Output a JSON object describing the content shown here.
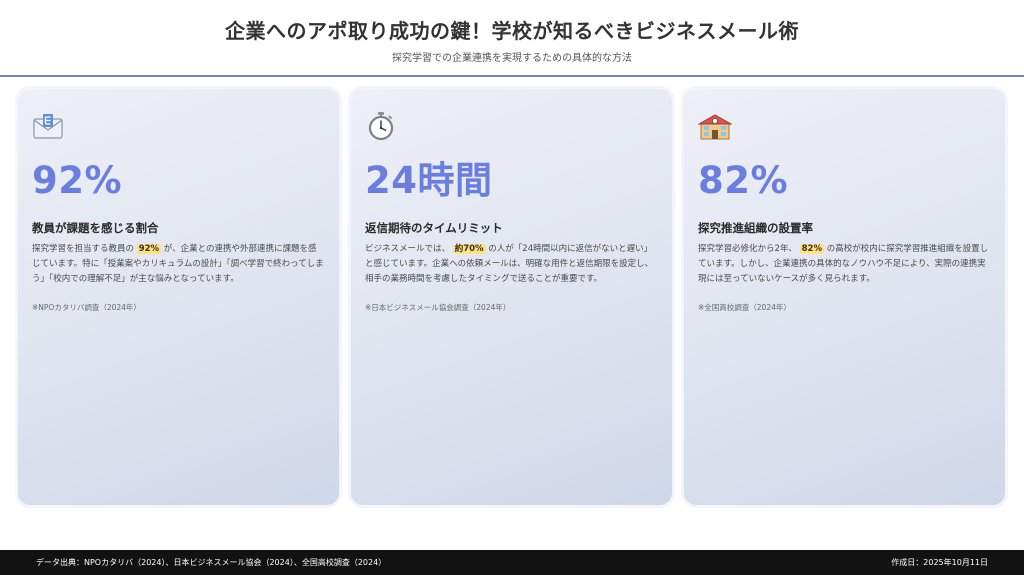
{
  "header": {
    "title": "企業へのアポ取り成功の鍵！学校が知るべきビジネスメール術",
    "subtitle": "探究学習での企業連携を実現するための具体的な方法"
  },
  "cards": [
    {
      "icon": "envelope-icon",
      "stat": "92%",
      "title": "教員が課題を感じる割合",
      "desc_before": "探究学習を担当する教員の",
      "highlight": "92%",
      "desc_after": "が、企業との連携や外部連携に課題を感じています。特に「授業案やカリキュラムの設計」「調べ学習で終わってしまう」「校内での理解不足」が主な悩みとなっています。",
      "source": "※NPOカタリバ調査（2024年）"
    },
    {
      "icon": "stopwatch-icon",
      "stat": "24時間",
      "title": "返信期待のタイムリミット",
      "desc_before": "ビジネスメールでは、",
      "highlight": "約70%",
      "desc_after": "の人が「24時間以内に返信がないと遅い」と感じています。企業への依頼メールは、明確な用件と返信期限を設定し、相手の業務時間を考慮したタイミングで送ることが重要です。",
      "source": "※日本ビジネスメール協会調査（2024年）"
    },
    {
      "icon": "school-icon",
      "stat": "82%",
      "title": "探究推進組織の設置率",
      "desc_before": "探究学習必修化から2年、",
      "highlight": "82%",
      "desc_after": "の高校が校内に探究学習推進組織を設置しています。しかし、企業連携の具体的なノウハウ不足により、実際の連携実現には至っていないケースが多く見られます。",
      "source": "※全国高校調査（2024年）"
    }
  ],
  "footer": {
    "sources": "データ出典：NPOカタリバ（2024）、日本ビジネスメール協会（2024）、全国高校調査（2024）",
    "created": "作成日：2025年10月11日"
  },
  "colors": {
    "accent": "#6a7ee0",
    "highlight": "#ffe27a",
    "footer_bg": "#121212"
  }
}
